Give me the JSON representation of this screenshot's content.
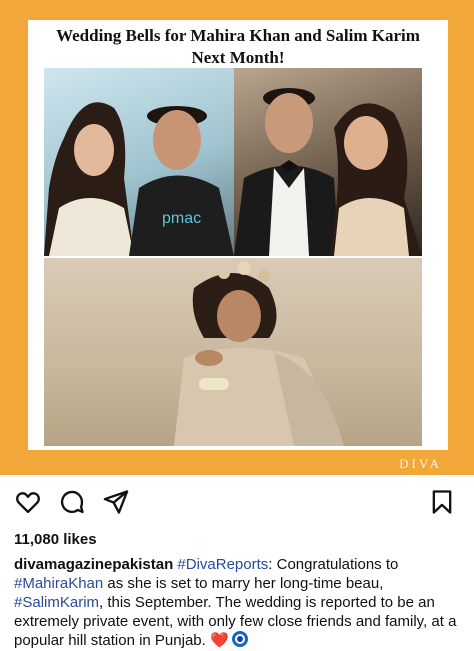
{
  "post": {
    "headline_line1": "Wedding Bells for Mahira Khan and Salim Karim",
    "headline_line2": "Next Month!",
    "photo_shirt_text": "pmac",
    "brand": "DIVA"
  },
  "actions": {
    "like_icon": "heart-icon",
    "comment_icon": "comment-icon",
    "share_icon": "send-icon",
    "save_icon": "bookmark-icon"
  },
  "likes": "11,080 likes",
  "caption": {
    "username": "divamagazinepakistan",
    "tag1": "#DivaReports",
    "text1": ": Congratulations to ",
    "tag2": "#MahiraKhan",
    "text2": " as she is set to marry her long-time beau, ",
    "tag3": "#SalimKarim",
    "text3": ", this September. The wedding is reported to be an extremely private event, with only few close friends and family, at a popular hill station in Punjab. ",
    "emoji_heart": "❤️"
  },
  "colors": {
    "frame": "#f2a73a",
    "hashtag": "#2a4a9a"
  }
}
